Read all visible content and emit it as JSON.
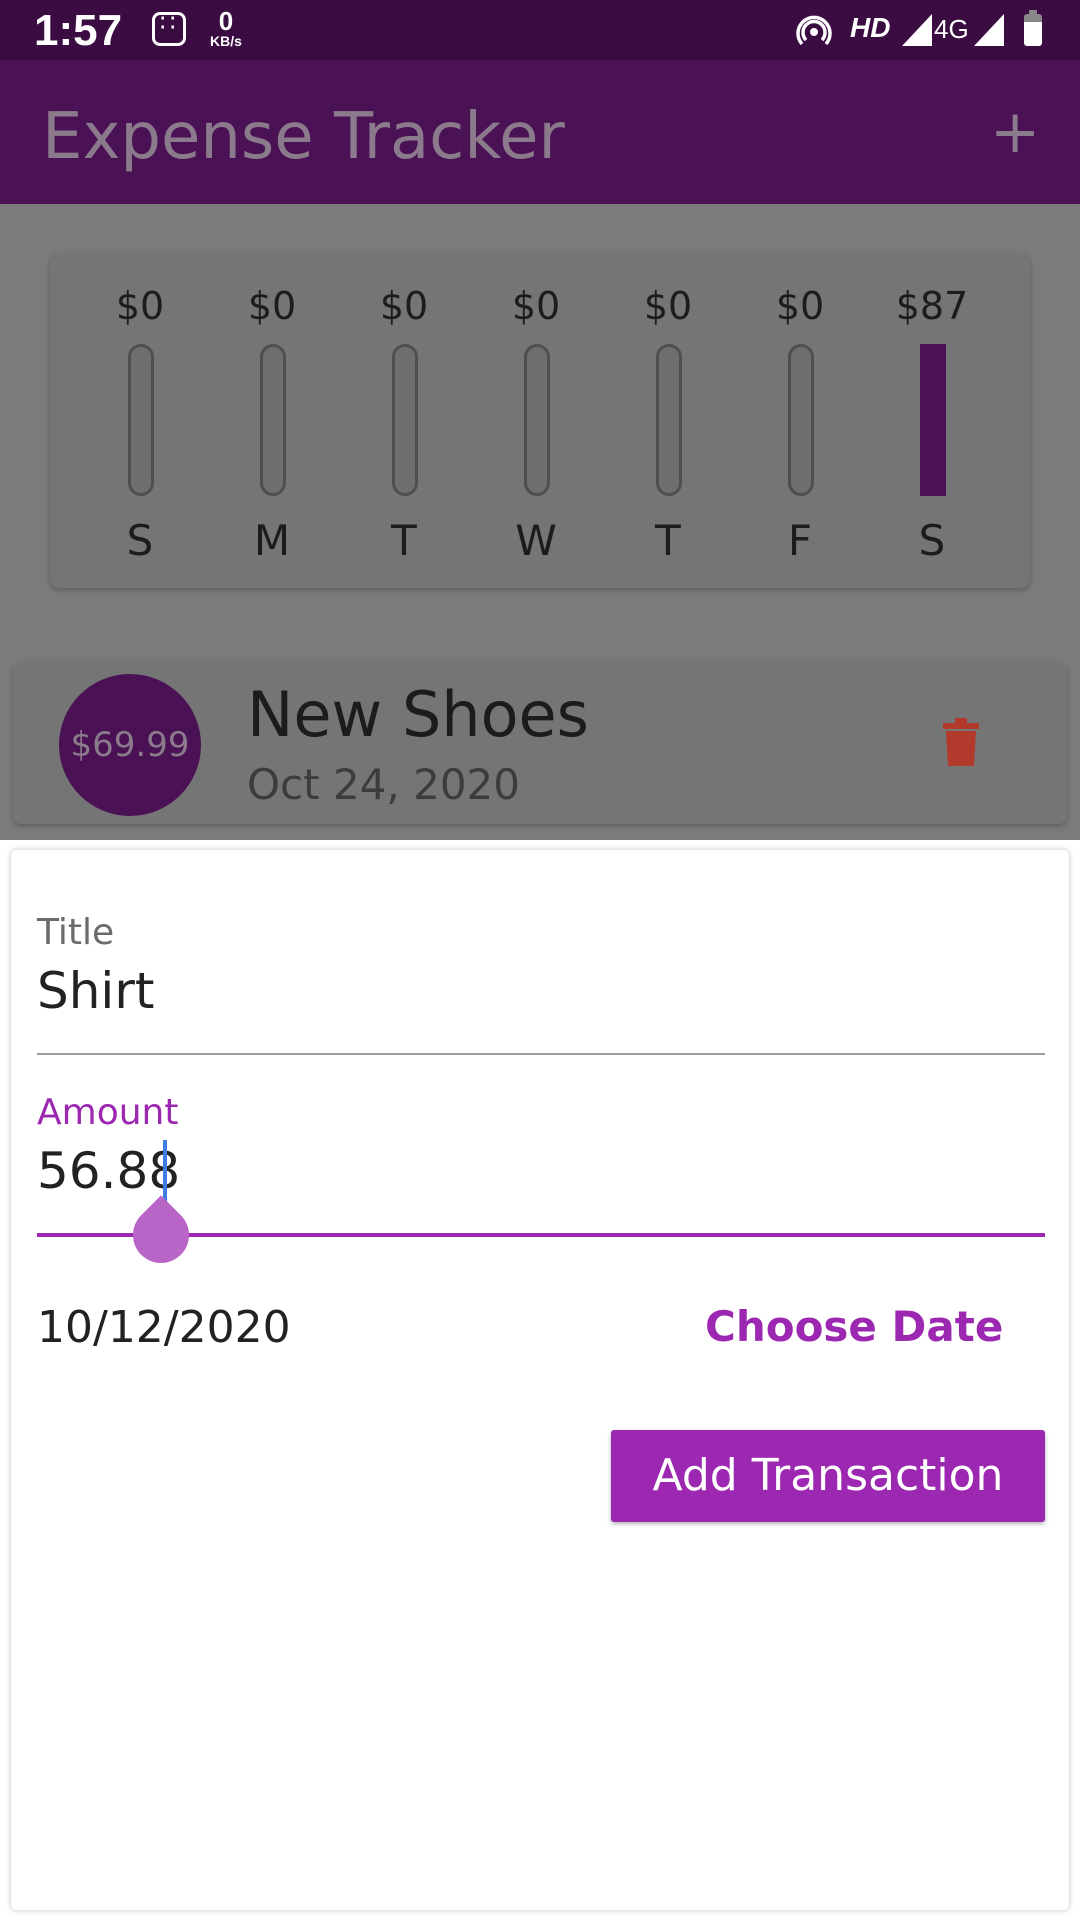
{
  "status_bar": {
    "time": "1:57",
    "net_speed_value": "0",
    "net_speed_unit": "KB/s",
    "hd_label": "HD",
    "network_label": "4G"
  },
  "app_bar": {
    "title": "Expense Tracker",
    "add_icon": "plus-icon"
  },
  "chart": {
    "bars": [
      {
        "amount": "$0",
        "day": "S",
        "fill": 0
      },
      {
        "amount": "$0",
        "day": "M",
        "fill": 0
      },
      {
        "amount": "$0",
        "day": "T",
        "fill": 0
      },
      {
        "amount": "$0",
        "day": "W",
        "fill": 0
      },
      {
        "amount": "$0",
        "day": "T",
        "fill": 0
      },
      {
        "amount": "$0",
        "day": "F",
        "fill": 0
      },
      {
        "amount": "$87",
        "day": "S",
        "fill": 1
      }
    ],
    "fill_color": "#4a1154"
  },
  "transactions": [
    {
      "amount": "$69.99",
      "title": "New Shoes",
      "date": "Oct 24, 2020",
      "delete_icon": "trash-icon"
    }
  ],
  "new_transaction": {
    "title_label": "Title",
    "title_value": "Shirt",
    "amount_label": "Amount",
    "amount_value": "56.88",
    "date_value": "10/12/2020",
    "choose_date_label": "Choose Date",
    "submit_label": "Add Transaction",
    "accent_color": "#9c27b0"
  }
}
